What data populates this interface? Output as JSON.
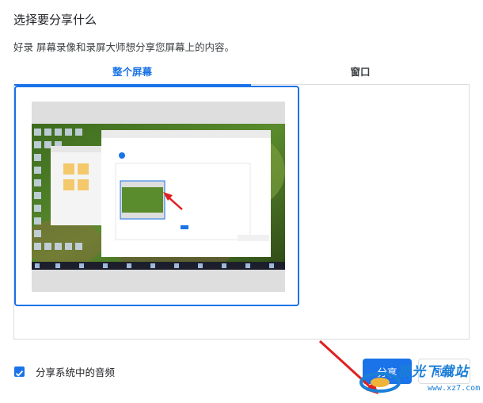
{
  "dialog": {
    "title": "选择要分享什么",
    "subtitle": "好录 屏幕录像和录屏大师想分享您屏幕上的内容。"
  },
  "tabs": [
    {
      "label": "整个屏幕",
      "active": true
    },
    {
      "label": "窗口",
      "active": false
    }
  ],
  "footer": {
    "audio_checkbox_label": "分享系统中的音频",
    "audio_checked": true,
    "share_label": "分享",
    "cancel_label": "取消"
  },
  "watermark": {
    "text": "极光下载站",
    "url": "www.xz7.com"
  },
  "colors": {
    "accent": "#1a73e8",
    "arrow": "#e02020"
  }
}
